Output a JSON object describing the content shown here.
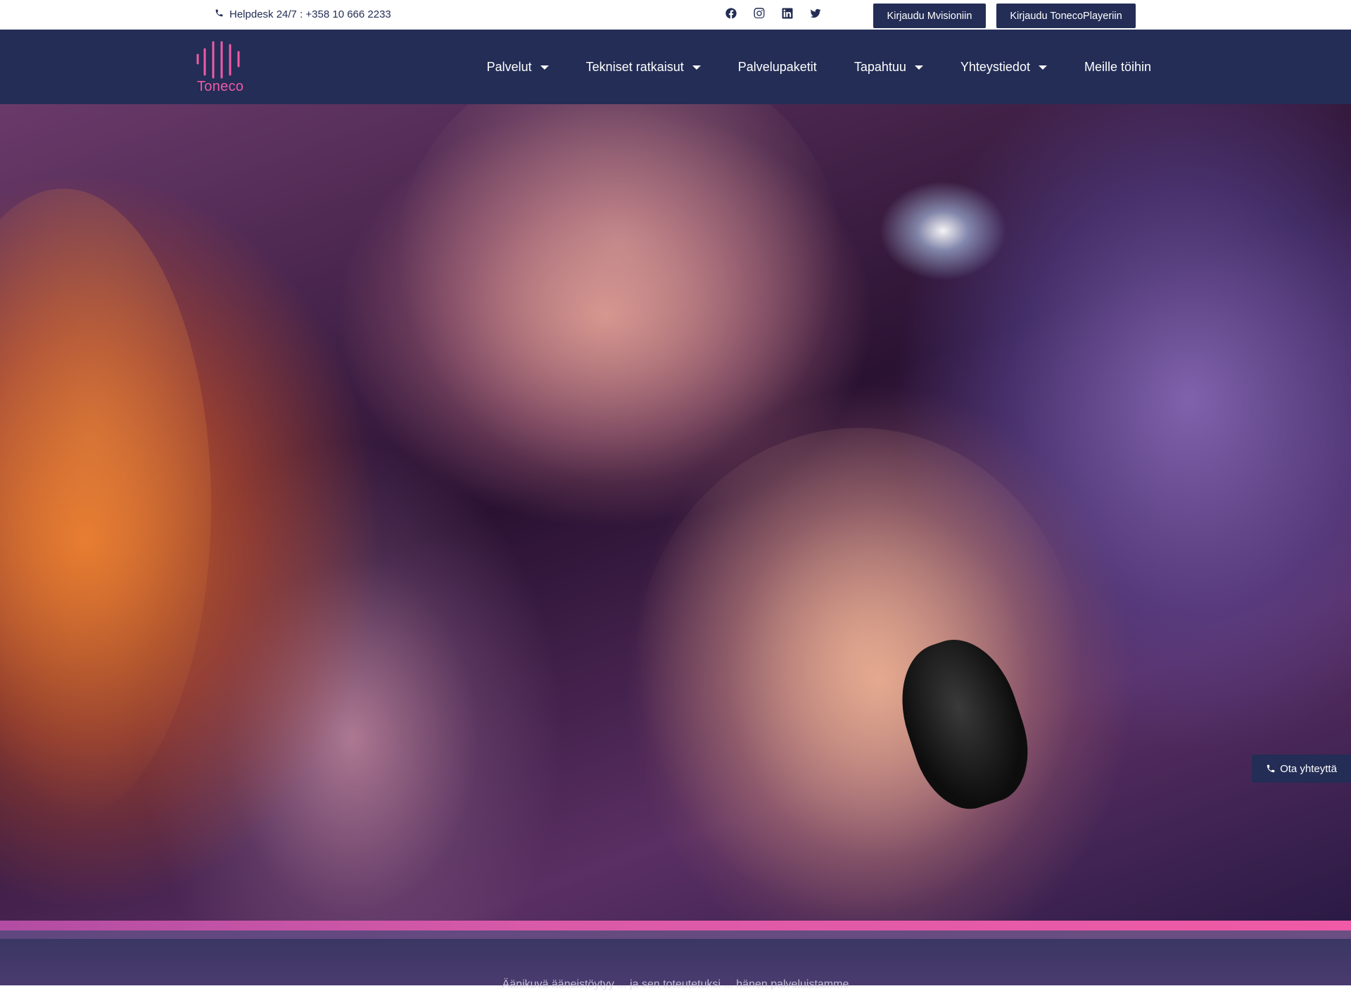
{
  "topbar": {
    "helpdesk_text": "Helpdesk 24/7 : +358 10 666 2233",
    "phone_icon": "phone-icon",
    "socials": [
      "facebook-icon",
      "instagram-icon",
      "linkedin-icon",
      "twitter-icon"
    ],
    "login_mvision_label": "Kirjaudu Mvisioniin",
    "login_toneco_label": "Kirjaudu TonecoPlayeriin"
  },
  "brand": {
    "name": "Toneco",
    "logo_color": "#f05aa6",
    "primary_color": "#232d55"
  },
  "nav": {
    "items": [
      {
        "label": "Palvelut",
        "has_dropdown": true
      },
      {
        "label": "Tekniset ratkaisut",
        "has_dropdown": true
      },
      {
        "label": "Palvelupaketit",
        "has_dropdown": false
      },
      {
        "label": "Tapahtuu",
        "has_dropdown": true
      },
      {
        "label": "Yhteystiedot",
        "has_dropdown": true
      },
      {
        "label": "Meille töihin",
        "has_dropdown": false
      }
    ]
  },
  "hero": {
    "image_alt": "karaoke"
  },
  "contact_tab": {
    "label": "Ota yhteyttä"
  },
  "section": {
    "partial_text": "Äänikuvä ääneistöytyy ... ja sen toteutetuksi ... hänen palveluistamme"
  }
}
